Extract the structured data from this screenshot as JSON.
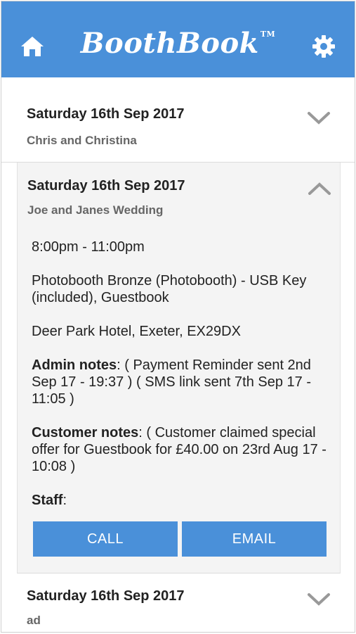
{
  "header": {
    "logo": "BoothBook",
    "trademark": "TM",
    "home_icon": "home-icon",
    "settings_icon": "gear-icon",
    "color": "#4a90d9"
  },
  "bookings": [
    {
      "date": "Saturday 16th Sep 2017",
      "title": "Chris and Christina",
      "state": "collapsed"
    },
    {
      "date": "Saturday 16th Sep 2017",
      "title": "Joe and Janes Wedding",
      "state": "expanded",
      "time": "8:00pm - 11:00pm",
      "package": "Photobooth Bronze (Photobooth) - USB Key (included), Guestbook",
      "venue": "Deer Park Hotel, Exeter, EX29DX",
      "admin_label": "Admin notes",
      "admin_text": ": ( Payment Reminder sent 2nd Sep 17 - 19:37 ) ( SMS link sent 7th Sep 17 - 11:05 )",
      "customer_label": "Customer notes",
      "customer_text": ": ( Customer claimed special offer for Guestbook for £40.00 on 23rd Aug 17 - 10:08 )",
      "staff_label": "Staff",
      "staff_text": ":",
      "call_label": "CALL",
      "email_label": "EMAIL"
    },
    {
      "date": "Saturday 16th Sep 2017",
      "title": "ad",
      "state": "collapsed"
    }
  ]
}
